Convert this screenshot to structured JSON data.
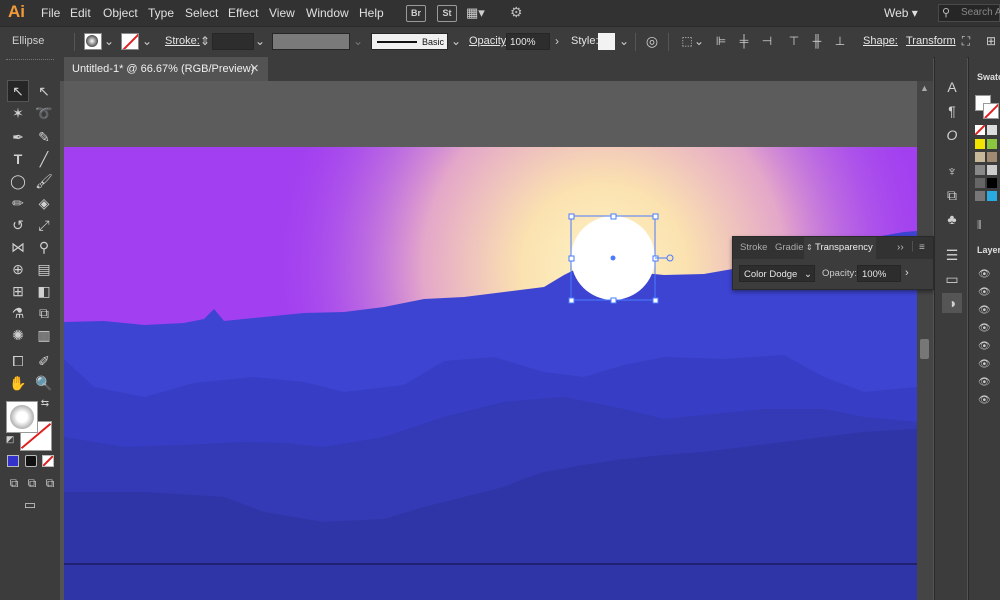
{
  "app": {
    "logo": "Ai",
    "workspace": "Web",
    "search_placeholder": "Search A"
  },
  "menu": [
    "File",
    "Edit",
    "Object",
    "Type",
    "Select",
    "Effect",
    "View",
    "Window",
    "Help"
  ],
  "menubar_icons": {
    "bridge": "Br",
    "stock": "St"
  },
  "control": {
    "object": "Ellipse",
    "stroke_label": "Stroke:",
    "stroke_profile": "Basic",
    "opacity_label": "Opacity:",
    "opacity_value": "100%",
    "style_label": "Style:",
    "shape_label": "Shape:",
    "transform_label": "Transform"
  },
  "document": {
    "tab_title": "Untitled-1* @ 66.67% (RGB/Preview)"
  },
  "transparency_panel": {
    "tabs": [
      "Stroke",
      "Gradie",
      "Transparency"
    ],
    "active_tab": "Transparency",
    "blend_mode": "Color Dodge",
    "opacity_label": "Opacity:",
    "opacity_value": "100%"
  },
  "panels": {
    "swatches_title": "Swatc",
    "layers_title": "Layers"
  },
  "colors": {
    "sky_left": "#a23ff0",
    "sky_glow": "#fbe6b4",
    "mountain_1": "#3d44d2",
    "mountain_2": "#373dc4",
    "mountain_3": "#3439b6",
    "selection": "#4a7bff",
    "ui_dark": "#323232",
    "ui_mid": "#3c3c3c"
  }
}
